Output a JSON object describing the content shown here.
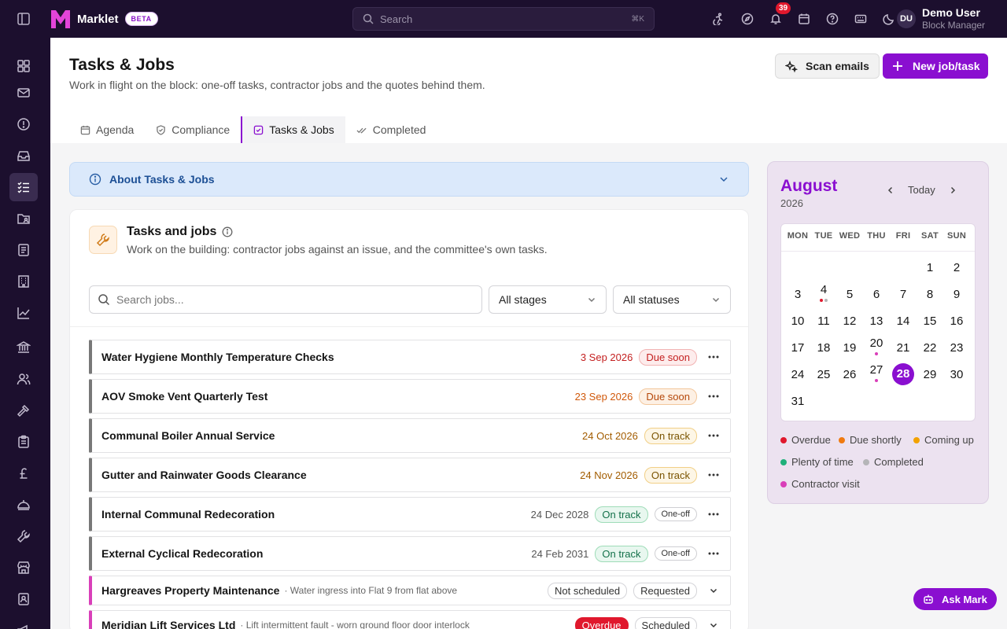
{
  "app": {
    "name": "Marklet",
    "badge": "BETA"
  },
  "topbar": {
    "search_placeholder": "Search",
    "search_shortcut": "⌘K",
    "notification_count": "39",
    "icons": [
      "accessibility-icon",
      "compass-icon",
      "bell-icon",
      "calendar-icon",
      "help-icon",
      "keyboard-icon",
      "moon-icon"
    ]
  },
  "user": {
    "initials": "DU",
    "name": "Demo User",
    "role": "Block Manager"
  },
  "sidebar": {
    "icons": [
      "dashboard-icon",
      "mail-icon",
      "alert-icon",
      "inbox-icon",
      "tasks-icon",
      "folder-user-icon",
      "ledger-icon",
      "building-icon",
      "chart-icon",
      "bank-icon",
      "people-icon",
      "hammer-icon",
      "clipboard-icon",
      "pound-icon",
      "insurance-icon",
      "wrench-icon",
      "store-icon",
      "contact-icon",
      "megaphone-icon"
    ],
    "active": "tasks-icon"
  },
  "page": {
    "title": "Tasks & Jobs",
    "subtitle": "Work in flight on the block: one-off tasks, contractor jobs and the quotes behind them.",
    "scan_label": "Scan emails",
    "new_label": "New job/task",
    "tabs": [
      {
        "label": "Agenda",
        "icon": "calendar-icon"
      },
      {
        "label": "Compliance",
        "icon": "shield-icon"
      },
      {
        "label": "Tasks & Jobs",
        "icon": "checkbox-icon",
        "active": true
      },
      {
        "label": "Completed",
        "icon": "double-check-icon"
      }
    ]
  },
  "about": {
    "label": "About Tasks & Jobs"
  },
  "card": {
    "title": "Tasks and jobs",
    "subtitle": "Work on the building: contractor jobs against an issue, and the committee's own tasks.",
    "search_placeholder": "Search jobs...",
    "stage_filter": "All stages",
    "status_filter": "All statuses"
  },
  "jobs": [
    {
      "name": "Water Hygiene Monthly Temperature Checks",
      "date": "3 Sep 2026",
      "status": "Due soon"
    },
    {
      "name": "AOV Smoke Vent Quarterly Test",
      "date": "23 Sep 2026",
      "status": "Due soon"
    },
    {
      "name": "Communal Boiler Annual Service",
      "date": "24 Oct 2026",
      "status": "On track"
    },
    {
      "name": "Gutter and Rainwater Goods Clearance",
      "date": "24 Nov 2026",
      "status": "On track"
    },
    {
      "name": "Internal Communal Redecoration",
      "date": "24 Dec 2028",
      "status": "On track",
      "tag": "One-off"
    },
    {
      "name": "External Cyclical Redecoration",
      "date": "24 Feb 2031",
      "status": "On track",
      "tag": "One-off"
    }
  ],
  "visits": [
    {
      "name": "Hargreaves Property Maintenance",
      "desc": "· Water ingress into Flat 9 from flat above",
      "schedule": "Not scheduled",
      "state": "Requested"
    },
    {
      "name": "Meridian Lift Services Ltd",
      "desc": "· Lift intermittent fault - worn ground floor door interlock",
      "schedule": "Overdue",
      "state": "Scheduled"
    }
  ],
  "calendar": {
    "month": "August",
    "year": "2026",
    "today_label": "Today",
    "weekdays": [
      "MON",
      "TUE",
      "WED",
      "THU",
      "FRI",
      "SAT",
      "SUN"
    ],
    "days": [
      "1",
      "2",
      "3",
      "4",
      "5",
      "6",
      "7",
      "8",
      "9",
      "10",
      "11",
      "12",
      "13",
      "14",
      "15",
      "16",
      "17",
      "18",
      "19",
      "20",
      "21",
      "22",
      "23",
      "24",
      "25",
      "26",
      "27",
      "28",
      "29",
      "30",
      "31"
    ],
    "selected_day": "28",
    "legend": [
      "Overdue",
      "Due shortly",
      "Coming up",
      "Plenty of time",
      "Completed",
      "Contractor visit"
    ],
    "colors": {
      "overdue": "#e0182d",
      "due_shortly": "#f07a10",
      "coming_up": "#f2a200",
      "plenty": "#1fb07a",
      "completed": "#b5b5b8",
      "visit": "#d93fb9"
    }
  },
  "assistant": {
    "label": "Ask Mark"
  }
}
